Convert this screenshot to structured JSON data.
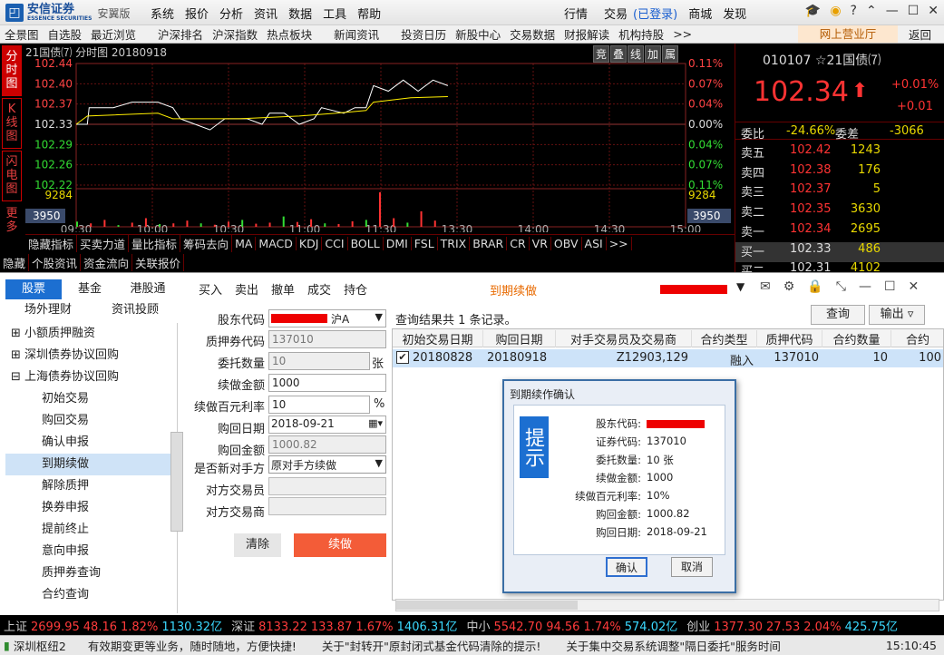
{
  "brand": {
    "cn": "安信证券",
    "en": "ESSENCE SECURITIES",
    "edition": "安翼版"
  },
  "menu": [
    "系统",
    "报价",
    "分析",
    "资讯",
    "数据",
    "工具",
    "帮助"
  ],
  "topright": {
    "market": "行情",
    "trade": "交易",
    "logged": "(已登录)",
    "mall": "商城",
    "discover": "发现"
  },
  "nav": [
    "全景图",
    "自选股",
    "最近浏览",
    "沪深排名",
    "沪深指数",
    "热点板块",
    "新闻资讯",
    "投资日历",
    "新股中心",
    "交易数据",
    "财报解读",
    "机构持股",
    ">>"
  ],
  "nav_web": "网上营业厅",
  "nav_back": "返回",
  "vtabs": [
    "分时图",
    "K线图",
    "闪电图",
    "更多"
  ],
  "chart": {
    "title": "21国债⑺ 分时图 20180918",
    "tools": [
      "竞",
      "叠",
      "线",
      "加",
      "属"
    ],
    "y_left": [
      "102.44",
      "102.40",
      "102.37",
      "102.33",
      "102.29",
      "102.26",
      "102.22",
      "9284",
      "3950"
    ],
    "y_right": [
      "0.11%",
      "0.07%",
      "0.04%",
      "0.00%",
      "0.04%",
      "0.07%",
      "0.11%",
      "9284",
      "3950"
    ],
    "x": [
      "09:30",
      "10:00",
      "10:30",
      "11:00",
      "11:30",
      "13:30",
      "14:00",
      "14:30",
      "15:00"
    ]
  },
  "chart_data": {
    "type": "line",
    "xlabel": "",
    "ylabel": "",
    "x": [
      "09:30",
      "10:00",
      "10:30",
      "11:00",
      "11:30",
      "13:30",
      "14:00",
      "14:30",
      "15:00"
    ],
    "ylim": [
      102.22,
      102.44
    ],
    "reference": 102.33,
    "series": [
      {
        "values": [
          102.33,
          102.35,
          102.37,
          102.37,
          102.37,
          102.36,
          102.32,
          102.34,
          102.35,
          102.36,
          102.4,
          102.39,
          102.41
        ]
      },
      {
        "values": [
          102.33,
          102.34,
          102.35,
          102.35,
          102.35,
          102.35,
          102.34,
          102.34,
          102.34,
          102.35,
          102.37,
          102.38,
          102.38
        ]
      }
    ],
    "volume_max": 9284
  },
  "indicators": [
    "隐藏指标",
    "买卖力道",
    "量比指标",
    "筹码去向",
    "MA",
    "MACD",
    "KDJ",
    "CCI",
    "BOLL",
    "DMI",
    "FSL",
    "TRIX",
    "BRAR",
    "CR",
    "VR",
    "OBV",
    "ASI",
    ">>"
  ],
  "subtabs": [
    "隐藏",
    "个股资讯",
    "资金流向",
    "关联报价"
  ],
  "quote": {
    "code": "010107",
    "star": "☆",
    "name": "21国债⑺",
    "price": "102.34",
    "pct": "+0.01%",
    "chg": "+0.01",
    "wb_label": "委比",
    "wb": "-24.66%",
    "wc_label": "委差",
    "wc": "-3066",
    "asks": [
      {
        "l": "卖五",
        "p": "102.42",
        "v": "1243"
      },
      {
        "l": "卖四",
        "p": "102.38",
        "v": "176"
      },
      {
        "l": "卖三",
        "p": "102.37",
        "v": "5"
      },
      {
        "l": "卖二",
        "p": "102.35",
        "v": "3630"
      },
      {
        "l": "卖一",
        "p": "102.34",
        "v": "2695"
      }
    ],
    "bids": [
      {
        "l": "买一",
        "p": "102.33",
        "v": "486"
      },
      {
        "l": "买二",
        "p": "102.31",
        "v": "4102"
      }
    ]
  },
  "trade": {
    "tabs": [
      "股票",
      "基金",
      "港股通",
      "场外理财",
      "资讯投顾"
    ],
    "toolbar": [
      "买入",
      "卖出",
      "撤单",
      "成交",
      "持仓"
    ],
    "current": "到期续做",
    "tree": [
      {
        "t": "⊞ 小额质押融资"
      },
      {
        "t": "⊞ 深圳债券协议回购"
      },
      {
        "t": "⊟ 上海债券协议回购"
      },
      {
        "t": "初始交易"
      },
      {
        "t": "购回交易"
      },
      {
        "t": "确认申报"
      },
      {
        "t": "到期续做"
      },
      {
        "t": "解除质押"
      },
      {
        "t": "换券申报"
      },
      {
        "t": "提前终止"
      },
      {
        "t": "意向申报"
      },
      {
        "t": "质押券查询"
      },
      {
        "t": "合约查询"
      }
    ],
    "form": {
      "shareholder_label": "股东代码",
      "shareholder_suffix": "沪A",
      "pledge_label": "质押券代码",
      "pledge": "137010",
      "qty_label": "委托数量",
      "qty": "10",
      "qty_unit": "张",
      "amount_label": "续做金额",
      "amount": "1000",
      "rate_label": "续做百元利率",
      "rate": "10",
      "rate_unit": "%",
      "date_label": "购回日期",
      "date": "2018-09-21",
      "redeem_label": "购回金额",
      "redeem": "1000.82",
      "newcp_label": "是否新对手方",
      "newcp": "原对手方续做",
      "cptrader_label": "对方交易员",
      "cpfirm_label": "对方交易商",
      "clear": "清除",
      "submit": "续做"
    },
    "result": "查询结果共 1 条记录。",
    "query_btn": "查询",
    "export_btn": "输出",
    "table": {
      "headers": [
        "初始交易日期",
        "购回日期",
        "对手交易员及交易商",
        "合约类型",
        "质押代码",
        "合约数量",
        "合约"
      ],
      "rows": [
        [
          "20180828",
          "20180918",
          "Z12903,129",
          "融入",
          "137010",
          "10",
          "100"
        ]
      ]
    }
  },
  "dialog": {
    "title": "到期续作确认",
    "badge": "提示",
    "rows": [
      {
        "k": "股东代码:",
        "v": ""
      },
      {
        "k": "证券代码:",
        "v": "137010"
      },
      {
        "k": "委托数量:",
        "v": "10 张"
      },
      {
        "k": "续做金额:",
        "v": "1000"
      },
      {
        "k": "续做百元利率:",
        "v": "10%"
      },
      {
        "k": "购回金额:",
        "v": "1000.82"
      },
      {
        "k": "购回日期:",
        "v": "2018-09-21"
      }
    ],
    "ok": "确认",
    "cancel": "取消"
  },
  "ticker": [
    {
      "n": "上证",
      "v": "2699.95",
      "c": "48.16",
      "p": "1.82%",
      "a": "1130.32亿"
    },
    {
      "n": "深证",
      "v": "8133.22",
      "c": "133.87",
      "p": "1.67%",
      "a": "1406.31亿"
    },
    {
      "n": "中小",
      "v": "5542.70",
      "c": "94.56",
      "p": "1.74%",
      "a": "574.02亿"
    },
    {
      "n": "创业",
      "v": "1377.30",
      "c": "27.53",
      "p": "2.04%",
      "a": "425.75亿"
    }
  ],
  "status": {
    "server": "深圳枢纽2",
    "news": [
      "有效期变更等业务，随时随地，方便快捷!",
      "关于\"封转开\"原封闭式基金代码清除的提示!",
      "关于集中交易系统调整\"隔日委托\"服务时间"
    ],
    "time": "15:10:45"
  }
}
